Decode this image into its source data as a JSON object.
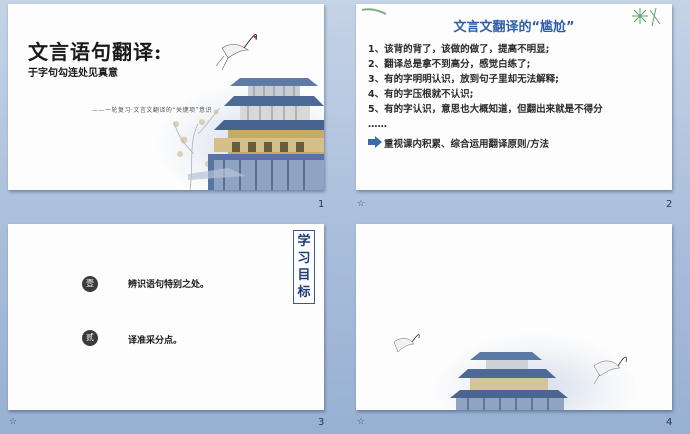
{
  "slides": [
    {
      "number": "1",
      "title": "文言语句翻译:",
      "subtitle": "于字句勾连处见真意",
      "note": "——一轮复习·文言文翻译的“关键项”意识"
    },
    {
      "number": "2",
      "title": "文言文翻译的“尴尬”",
      "items": [
        "1、该背的背了，该做的做了，提高不明显;",
        "2、翻译总是拿不到高分，感觉白练了;",
        "3、有的字明明认识，放到句子里却无法解释;",
        "4、有的字压根就不认识;",
        "5、有的字认识，意思也大概知道，但翻出来就是不得分",
        "……"
      ],
      "note": "重视课内积累、综合运用翻译原则/方法",
      "star": "☆"
    },
    {
      "number": "3",
      "vertical_title": "学习目标",
      "goals": [
        {
          "marker": "壹",
          "text": "辨识语句特别之处。"
        },
        {
          "marker": "贰",
          "text": "译准采分点。"
        }
      ],
      "star": "☆"
    },
    {
      "number": "4",
      "star": "☆"
    }
  ],
  "colors": {
    "background": "#a9bedb",
    "accent_blue": "#2f5fa8",
    "slide_bg": "#fdfdfd"
  }
}
